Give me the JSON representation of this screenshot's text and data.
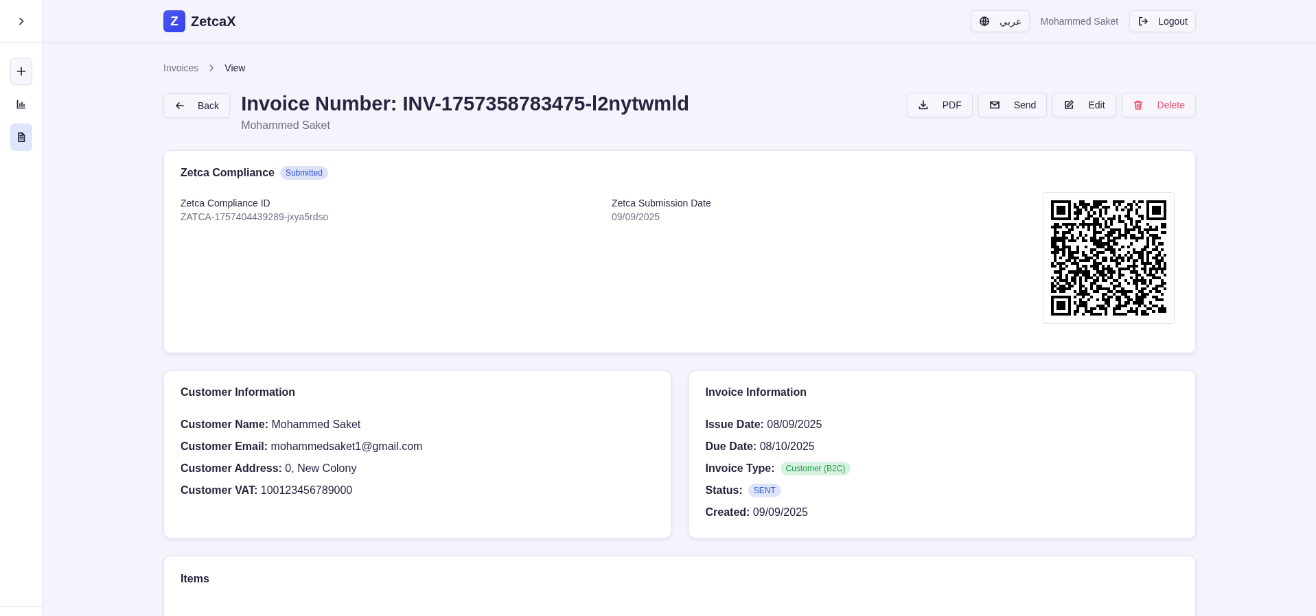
{
  "sidebar": {
    "items": [
      {
        "kind": "add",
        "selected": false,
        "boxed": true
      },
      {
        "kind": "chart",
        "selected": false,
        "boxed": false
      },
      {
        "kind": "document",
        "selected": true,
        "boxed": false
      }
    ]
  },
  "header": {
    "logo_letter": "Z",
    "brand": "ZetcaX",
    "language": "عربي",
    "user": "Mohammed Saket",
    "logout": "Logout"
  },
  "breadcrumb": [
    "Invoices",
    "View"
  ],
  "back": "Back",
  "title": "Invoice Number: INV-1757358783475-l2nytwmld",
  "subtitle": "Mohammed Saket",
  "actions": [
    {
      "kind": "download",
      "label": "PDF",
      "danger": false
    },
    {
      "kind": "mail",
      "label": "Send",
      "danger": false
    },
    {
      "kind": "edit",
      "label": "Edit",
      "danger": false
    },
    {
      "kind": "trash",
      "label": "Delete",
      "danger": true
    }
  ],
  "compliance": {
    "title": "Zetca Compliance",
    "badge": {
      "text": "Submitted",
      "color": "#2f4fd8"
    },
    "fields": [
      {
        "label": "Zetca Compliance ID",
        "value": "ZATCA-1757404439289-jxya5rdso"
      },
      {
        "label": "Zetca Submission Date",
        "value": "09/09/2025"
      }
    ]
  },
  "customer": {
    "title": "Customer Information",
    "fields": [
      {
        "kind": "text",
        "label": "Customer Name:",
        "value": "Mohammed Saket"
      },
      {
        "kind": "text",
        "label": "Customer Email:",
        "value": "mohammedsaket1@gmail.com"
      },
      {
        "kind": "text",
        "label": "Customer Address:",
        "value": "0, New Colony"
      },
      {
        "kind": "text",
        "label": "Customer VAT:",
        "value": "100123456789000"
      }
    ]
  },
  "invoice": {
    "title": "Invoice Information",
    "fields": [
      {
        "kind": "text",
        "label": "Issue Date:",
        "value": "08/09/2025"
      },
      {
        "kind": "text",
        "label": "Due Date:",
        "value": "08/10/2025"
      },
      {
        "kind": "badge",
        "label": "Invoice Type:",
        "value": "Customer (B2C)",
        "color": "#16a34a"
      },
      {
        "kind": "badge",
        "label": "Status:",
        "value": "SENT",
        "color": "#2f5be0"
      },
      {
        "kind": "text",
        "label": "Created:",
        "value": "09/09/2025"
      }
    ]
  },
  "items": {
    "title": "Items"
  }
}
